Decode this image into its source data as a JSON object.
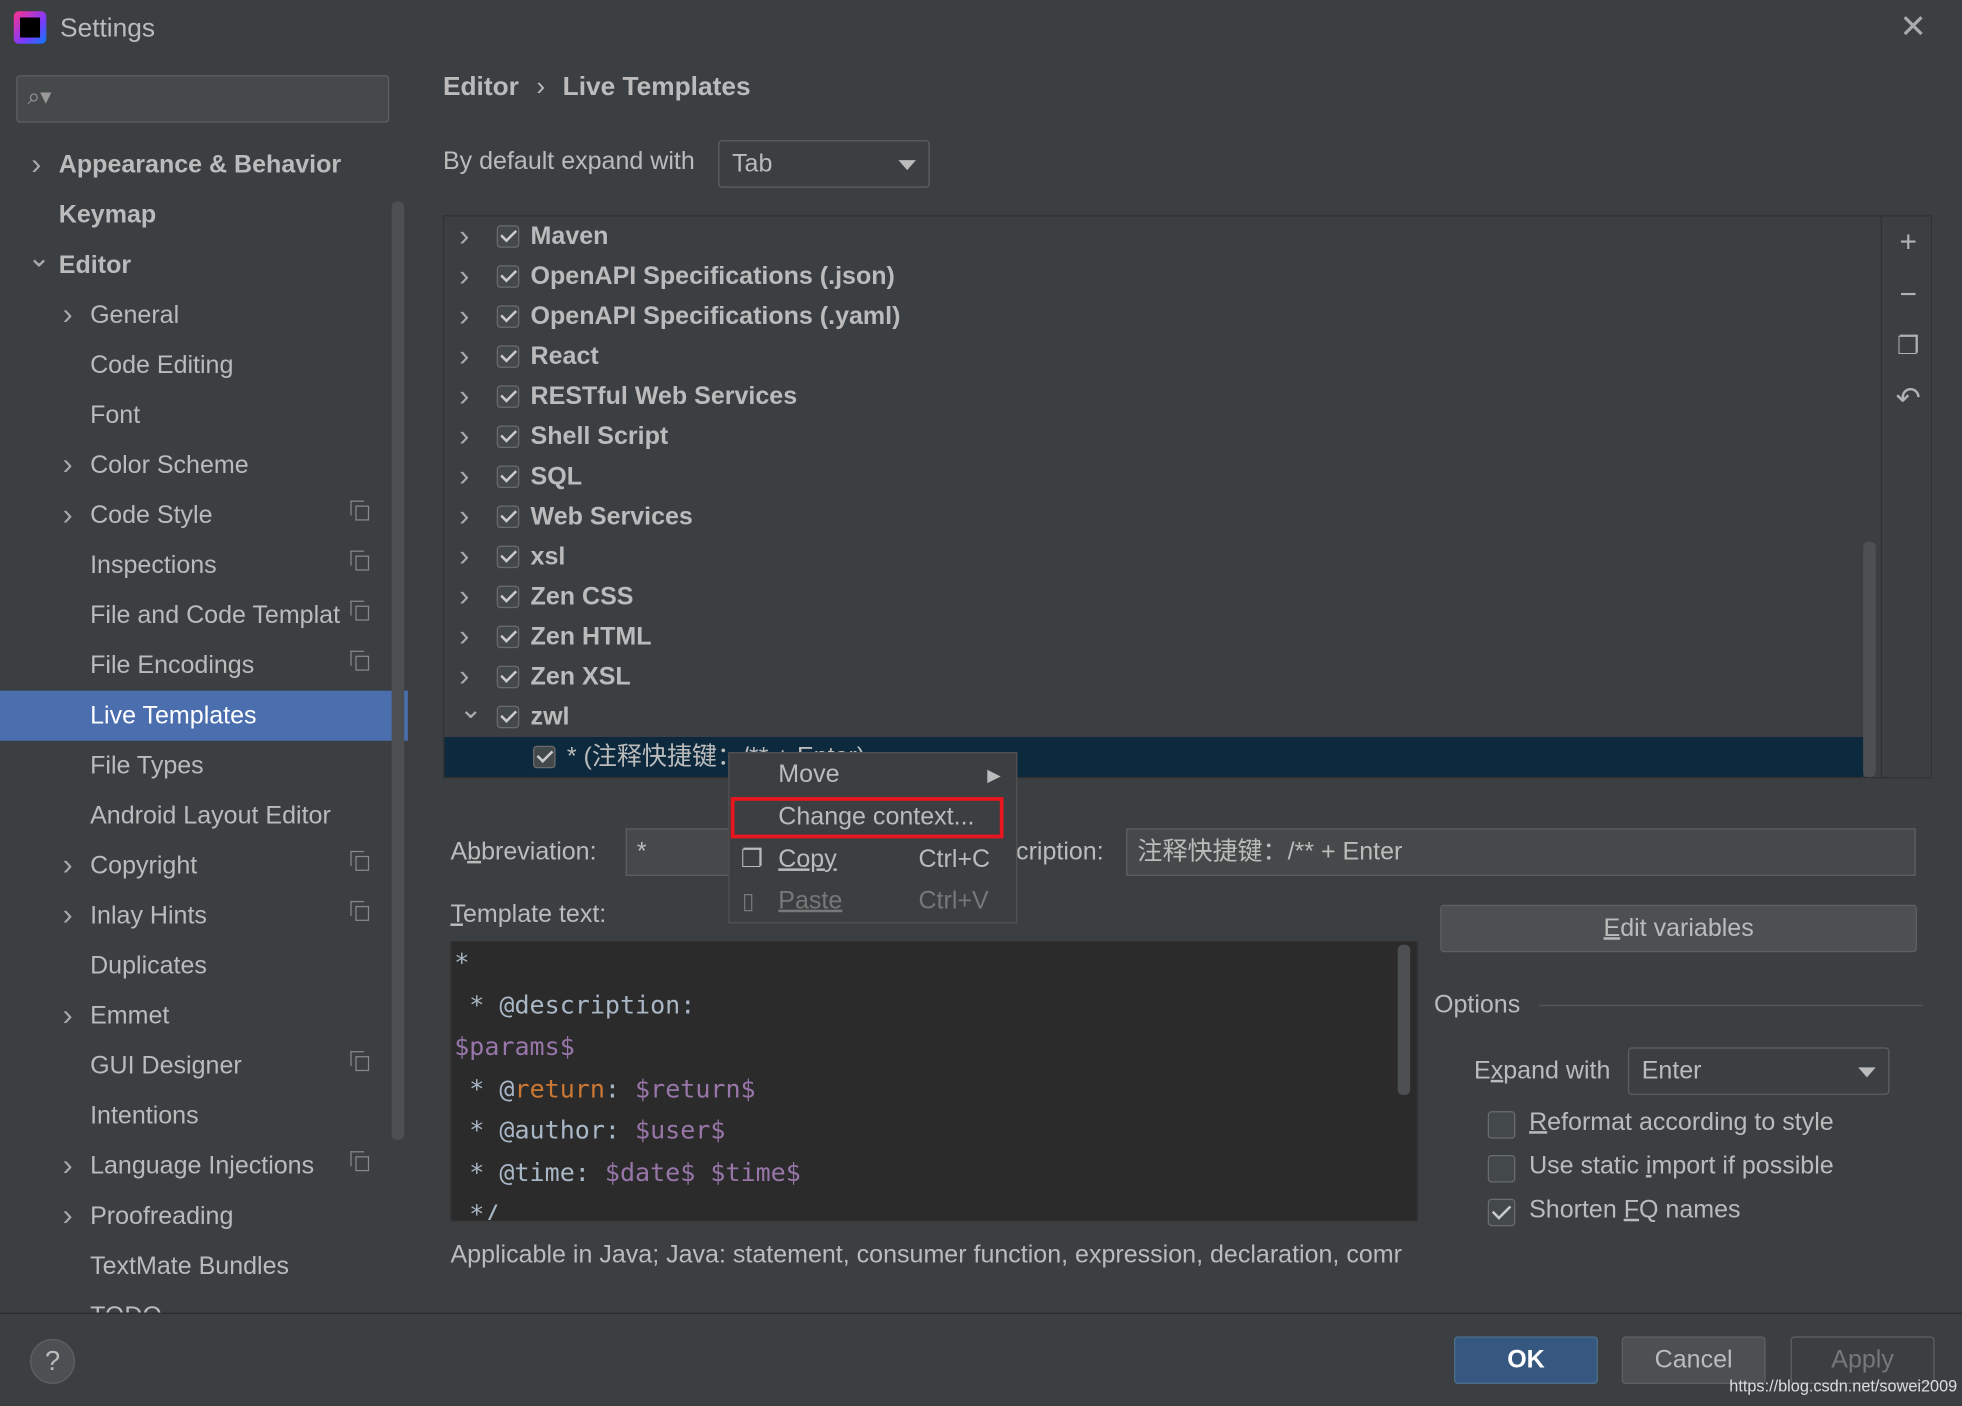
{
  "window": {
    "title": "Settings",
    "close_icon": "close-icon"
  },
  "search": {
    "placeholder": "",
    "value": ""
  },
  "sidebar": {
    "items": [
      {
        "label": "Appearance & Behavior",
        "level": 0,
        "expand": "collapsed",
        "bold": true
      },
      {
        "label": "Keymap",
        "level": 0,
        "expand": "none",
        "bold": true
      },
      {
        "label": "Editor",
        "level": 0,
        "expand": "expanded",
        "bold": true
      },
      {
        "label": "General",
        "level": 1,
        "expand": "collapsed"
      },
      {
        "label": "Code Editing",
        "level": 1,
        "expand": "none"
      },
      {
        "label": "Font",
        "level": 1,
        "expand": "none"
      },
      {
        "label": "Color Scheme",
        "level": 1,
        "expand": "collapsed"
      },
      {
        "label": "Code Style",
        "level": 1,
        "expand": "collapsed",
        "copy": true
      },
      {
        "label": "Inspections",
        "level": 1,
        "expand": "none",
        "copy": true
      },
      {
        "label": "File and Code Templat",
        "level": 1,
        "expand": "none",
        "copy": true
      },
      {
        "label": "File Encodings",
        "level": 1,
        "expand": "none",
        "copy": true
      },
      {
        "label": "Live Templates",
        "level": 1,
        "expand": "none",
        "selected": true
      },
      {
        "label": "File Types",
        "level": 1,
        "expand": "none"
      },
      {
        "label": "Android Layout Editor",
        "level": 1,
        "expand": "none"
      },
      {
        "label": "Copyright",
        "level": 1,
        "expand": "collapsed",
        "copy": true
      },
      {
        "label": "Inlay Hints",
        "level": 1,
        "expand": "collapsed",
        "copy": true
      },
      {
        "label": "Duplicates",
        "level": 1,
        "expand": "none"
      },
      {
        "label": "Emmet",
        "level": 1,
        "expand": "collapsed"
      },
      {
        "label": "GUI Designer",
        "level": 1,
        "expand": "none",
        "copy": true
      },
      {
        "label": "Intentions",
        "level": 1,
        "expand": "none"
      },
      {
        "label": "Language Injections",
        "level": 1,
        "expand": "collapsed",
        "copy": true
      },
      {
        "label": "Proofreading",
        "level": 1,
        "expand": "collapsed"
      },
      {
        "label": "TextMate Bundles",
        "level": 1,
        "expand": "none"
      },
      {
        "label": "TODO",
        "level": 1,
        "expand": "none"
      }
    ]
  },
  "breadcrumb": [
    "Editor",
    "Live Templates"
  ],
  "expand_default": {
    "label": "By default expand with",
    "value": "Tab"
  },
  "template_groups": [
    {
      "name": "Maven",
      "checked": true,
      "expand": "collapsed"
    },
    {
      "name": "OpenAPI Specifications (.json)",
      "checked": true,
      "expand": "collapsed"
    },
    {
      "name": "OpenAPI Specifications (.yaml)",
      "checked": true,
      "expand": "collapsed"
    },
    {
      "name": "React",
      "checked": true,
      "expand": "collapsed"
    },
    {
      "name": "RESTful Web Services",
      "checked": true,
      "expand": "collapsed"
    },
    {
      "name": "Shell Script",
      "checked": true,
      "expand": "collapsed"
    },
    {
      "name": "SQL",
      "checked": true,
      "expand": "collapsed"
    },
    {
      "name": "Web Services",
      "checked": true,
      "expand": "collapsed"
    },
    {
      "name": "xsl",
      "checked": true,
      "expand": "collapsed"
    },
    {
      "name": "Zen CSS",
      "checked": true,
      "expand": "collapsed"
    },
    {
      "name": "Zen HTML",
      "checked": true,
      "expand": "collapsed"
    },
    {
      "name": "Zen XSL",
      "checked": true,
      "expand": "collapsed"
    },
    {
      "name": "zwl",
      "checked": true,
      "expand": "expanded"
    }
  ],
  "selected_template": {
    "label": "* (注释快捷键：/** + Enter)",
    "checked": true
  },
  "toolbar_icons": [
    "plus-icon",
    "minus-icon",
    "copy-icon",
    "undo-icon"
  ],
  "context_menu": {
    "items": [
      {
        "label": "Move",
        "submenu": true
      },
      {
        "label": "Change context...",
        "highlighted": true
      },
      {
        "label": "Copy",
        "shortcut": "Ctrl+C",
        "icon": "copy-icon"
      },
      {
        "label": "Paste",
        "shortcut": "Ctrl+V",
        "icon": "paste-icon",
        "disabled": true
      }
    ],
    "highlight_color": "#e8161e"
  },
  "abbreviation": {
    "label_pre": "A",
    "label_u": "b",
    "label_post": "breviation:",
    "value": "*"
  },
  "description": {
    "label": "cription:",
    "value": "注释快捷键：/** + Enter"
  },
  "template_text": {
    "label_u": "T",
    "label_post": "emplate text:",
    "lines": [
      [
        {
          "t": "*",
          "c": "plain"
        }
      ],
      [
        {
          "t": " * @description:",
          "c": "plain"
        }
      ],
      [
        {
          "t": "$params$",
          "c": "var"
        }
      ],
      [
        {
          "t": " * @",
          "c": "plain"
        },
        {
          "t": "return",
          "c": "kw"
        },
        {
          "t": ": ",
          "c": "plain"
        },
        {
          "t": "$return$",
          "c": "var"
        }
      ],
      [
        {
          "t": " * @author: ",
          "c": "plain"
        },
        {
          "t": "$user$",
          "c": "var"
        }
      ],
      [
        {
          "t": " * @time: ",
          "c": "plain"
        },
        {
          "t": "$date$ $time$",
          "c": "var"
        }
      ],
      [
        {
          "t": " */",
          "c": "plain"
        }
      ]
    ]
  },
  "edit_variables": {
    "label_u": "E",
    "label_post": "dit variables"
  },
  "options": {
    "title": "Options",
    "expand_with": {
      "label_pre": "E",
      "label_u": "x",
      "label_post": "pand with",
      "value": "Enter"
    },
    "checkboxes": [
      {
        "pre": "",
        "u": "R",
        "post": "eformat according to style",
        "checked": false
      },
      {
        "pre": "Use static ",
        "u": "i",
        "post": "mport if possible",
        "checked": false
      },
      {
        "pre": "Shorten ",
        "u": "F",
        "post": "Q names",
        "checked": true
      }
    ]
  },
  "applicable": "Applicable in Java; Java: statement, consumer function, expression, declaration, comr",
  "buttons": {
    "ok": "OK",
    "cancel": "Cancel",
    "apply": "Apply",
    "help": "?"
  },
  "watermark": "https://blog.csdn.net/sowei2009",
  "colors": {
    "selection": "#4b6eaf",
    "tree_selection": "#0d293e",
    "background": "#3c3f41",
    "editor_bg": "#2b2b2b",
    "keyword": "#cc7832",
    "variable": "#9876aa"
  }
}
